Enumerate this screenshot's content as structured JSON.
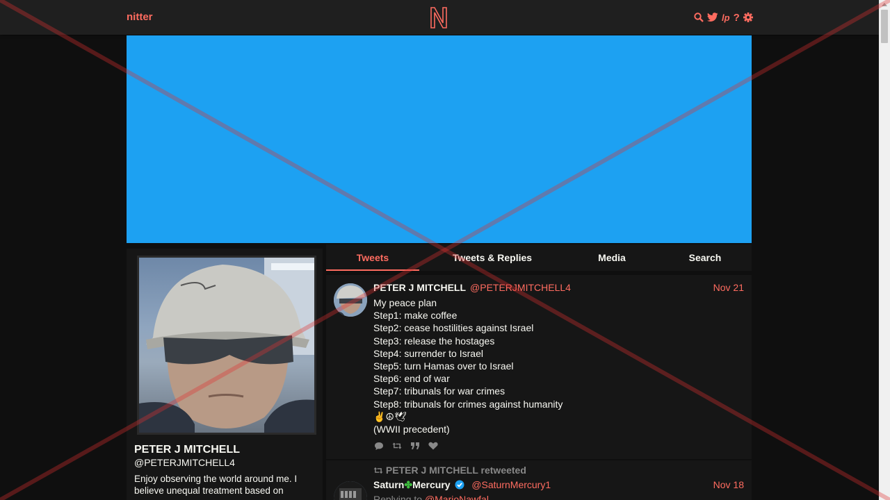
{
  "nav": {
    "site_name": "nitter",
    "logo_letter": "N",
    "icons": [
      "search-icon",
      "twitter-icon",
      "rss-icon",
      "help-icon",
      "settings-icon"
    ],
    "rss_text": "lp",
    "help_text": "?"
  },
  "colors": {
    "accent": "#ff6c60",
    "banner": "#1da1f2",
    "background": "#0f0f0f",
    "panel": "#161616"
  },
  "profile": {
    "fullname": "PETER J MITCHELL",
    "handle": "@PETERJMITCHELL4",
    "bio": "Enjoy observing the world around me. I believe unequal treatment based on"
  },
  "tabs": [
    {
      "label": "Tweets",
      "active": true
    },
    {
      "label": "Tweets & Replies",
      "active": false
    },
    {
      "label": "Media",
      "active": false
    },
    {
      "label": "Search",
      "active": false
    }
  ],
  "tweets": [
    {
      "fullname": "PETER J MITCHELL",
      "handle": "@PETERJMITCHELL4",
      "date": "Nov 21",
      "lines": [
        "My peace plan",
        "Step1: make coffee",
        "Step2: cease hostilities against Israel",
        "Step3: release the hostages",
        "Step4: surrender to Israel",
        "Step5: turn Hamas over to Israel",
        "Step6: end of war",
        "Step7: tribunals for war crimes",
        "Step8: tribunals for crimes against humanity",
        "✌☮🕊",
        "(WWII precedent)"
      ],
      "stat_icons": [
        "comment-icon",
        "retweet-icon",
        "quote-icon",
        "heart-icon"
      ]
    },
    {
      "retweeted_by": "PETER J MITCHELL retweeted",
      "fullname_a": "Saturn",
      "fullname_b": "Mercury",
      "handle": "@SaturnMercury1",
      "date": "Nov 18",
      "reply_prefix": "Replying to",
      "reply_to": "@MarioNawfal"
    }
  ]
}
